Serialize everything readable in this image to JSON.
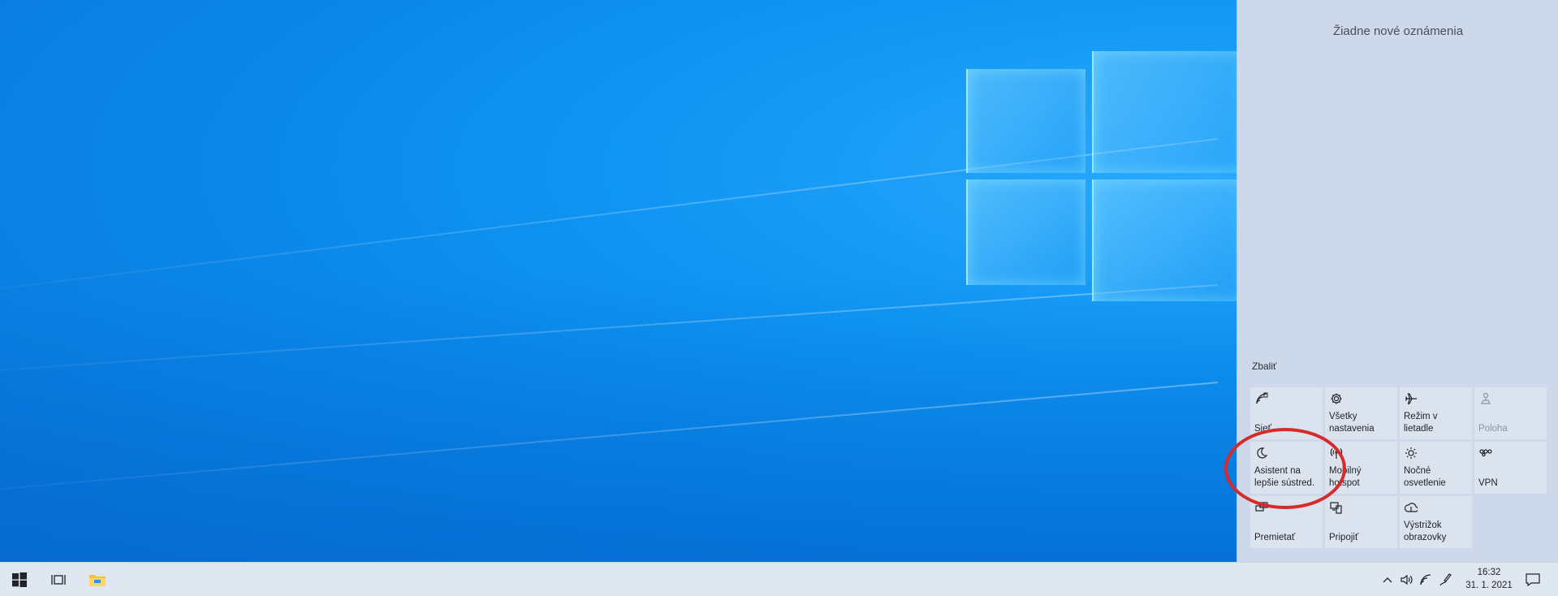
{
  "action_center": {
    "no_notifications": "Žiadne nové oznámenia",
    "collapse": "Zbaliť",
    "tiles": [
      {
        "label": "Sieť",
        "icon": "network-icon",
        "disabled": false
      },
      {
        "label": "Všetky nastavenia",
        "icon": "gear-icon",
        "disabled": false
      },
      {
        "label": "Režim v lietadle",
        "icon": "airplane-icon",
        "disabled": false
      },
      {
        "label": "Poloha",
        "icon": "location-icon",
        "disabled": true
      },
      {
        "label": "Asistent na lepšie sústred.",
        "icon": "moon-icon",
        "disabled": false
      },
      {
        "label": "Mobilný hotspot",
        "icon": "hotspot-icon",
        "disabled": false
      },
      {
        "label": "Nočné osvetlenie",
        "icon": "brightness-icon",
        "disabled": false
      },
      {
        "label": "VPN",
        "icon": "vpn-icon",
        "disabled": false
      },
      {
        "label": "Premietať",
        "icon": "project-icon",
        "disabled": false
      },
      {
        "label": "Pripojiť",
        "icon": "connect-icon",
        "disabled": false
      },
      {
        "label": "Výstrižok obrazovky",
        "icon": "snip-icon",
        "disabled": false
      }
    ]
  },
  "taskbar": {
    "time": "16:32",
    "date": "31. 1. 2021"
  },
  "colors": {
    "annotation": "#d62b2b",
    "action_center_bg": "#cdd8ea",
    "taskbar_bg": "#dfe7f0"
  }
}
